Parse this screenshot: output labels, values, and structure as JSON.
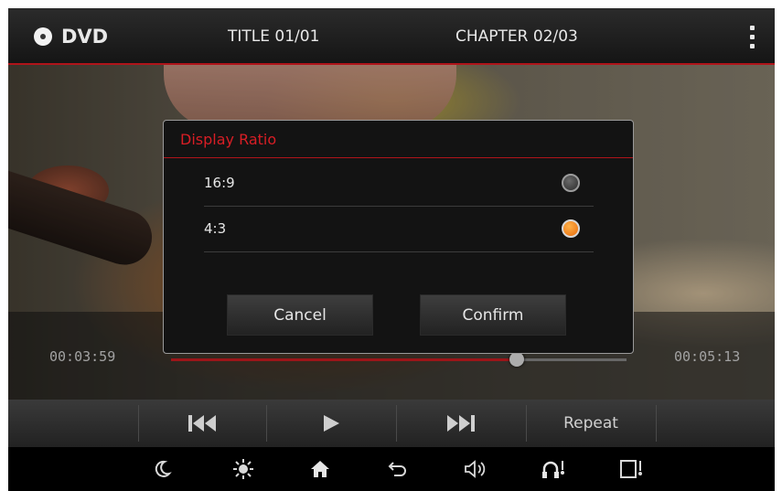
{
  "topbar": {
    "source": "DVD",
    "title": "TITLE 01/01",
    "chapter": "CHAPTER 02/03",
    "icons": {
      "disc": "dvd-disc-icon",
      "menu": "more-vertical-icon"
    }
  },
  "playback": {
    "elapsed": "00:03:59",
    "total": "00:05:13",
    "progress_fraction": 0.76,
    "colors": {
      "progress": "#d01c22",
      "accent": "#d81e25"
    }
  },
  "controls": {
    "prev_icon": "skip-previous-icon",
    "play_icon": "play-icon",
    "next_icon": "skip-next-icon",
    "repeat_label": "Repeat"
  },
  "dialog": {
    "title": "Display Ratio",
    "options": [
      {
        "label": "16:9",
        "selected": false
      },
      {
        "label": "4:3",
        "selected": true
      }
    ],
    "cancel_label": "Cancel",
    "confirm_label": "Confirm",
    "selected_color": "#f08a1c"
  },
  "bottombar": {
    "icons": [
      "night-mode-icon",
      "brightness-icon",
      "home-icon",
      "back-icon",
      "volume-icon",
      "voice-call-icon",
      "screen-off-icon"
    ]
  }
}
